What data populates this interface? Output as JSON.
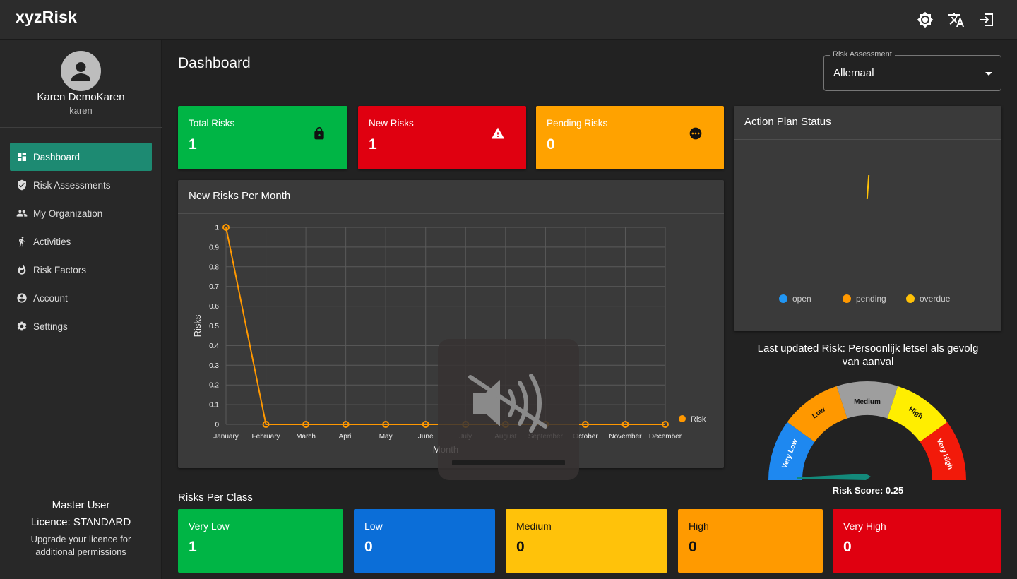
{
  "app": {
    "logo": "xyzRisk"
  },
  "topbar": {
    "icons": [
      "brightness-icon",
      "translate-icon",
      "logout-icon"
    ]
  },
  "user": {
    "name": "Karen DemoKaren",
    "login": "karen"
  },
  "nav": {
    "items": [
      {
        "label": "Dashboard",
        "icon": "dashboard-icon",
        "active": true
      },
      {
        "label": "Risk Assessments",
        "icon": "shield-check-icon",
        "active": false
      },
      {
        "label": "My Organization",
        "icon": "people-icon",
        "active": false
      },
      {
        "label": "Activities",
        "icon": "walk-icon",
        "active": false
      },
      {
        "label": "Risk Factors",
        "icon": "fire-icon",
        "active": false
      },
      {
        "label": "Account",
        "icon": "account-circle-icon",
        "active": false
      },
      {
        "label": "Settings",
        "icon": "gear-icon",
        "active": false
      }
    ]
  },
  "licence": {
    "role": "Master User",
    "type": "Licence: STANDARD",
    "note": "Upgrade your licence for additional permissions"
  },
  "page": {
    "title": "Dashboard"
  },
  "filter": {
    "label": "Risk Assessment",
    "value": "Allemaal"
  },
  "stats": [
    {
      "label": "Total Risks",
      "value": "1",
      "color": "#00b545",
      "icon": "lock-icon"
    },
    {
      "label": "New Risks",
      "value": "1",
      "color": "#e00010",
      "icon": "warning-icon"
    },
    {
      "label": "Pending Risks",
      "value": "0",
      "color": "#ffa200",
      "icon": "more-horiz-circle-icon"
    }
  ],
  "line_panel": {
    "title": "New Risks Per Month"
  },
  "action_panel": {
    "title": "Action Plan Status",
    "legend": [
      {
        "label": "open",
        "color": "#2196f3"
      },
      {
        "label": "pending",
        "color": "#ff9800"
      },
      {
        "label": "overdue",
        "color": "#ffc107"
      }
    ]
  },
  "gauge": {
    "title": "Last updated Risk: Persoonlijk letsel als gevolg van aanval",
    "score_label": "Risk Score: 0.25",
    "segments": [
      {
        "label": "Very Low",
        "color": "#1e88f0"
      },
      {
        "label": "Low",
        "color": "#ff9800"
      },
      {
        "label": "Medium",
        "color": "#9e9e9e"
      },
      {
        "label": "High",
        "color": "#ffee00"
      },
      {
        "label": "Very High",
        "color": "#f21a0a"
      }
    ],
    "needle_color": "#13897a"
  },
  "classes": {
    "title": "Risks Per Class",
    "items": [
      {
        "label": "Very Low",
        "value": "1",
        "color": "#00b545"
      },
      {
        "label": "Low",
        "value": "0",
        "color": "#0b6ed8"
      },
      {
        "label": "Medium",
        "value": "0",
        "color": "#ffc20a"
      },
      {
        "label": "High",
        "value": "0",
        "color": "#ff9a00"
      },
      {
        "label": "Very High",
        "value": "0",
        "color": "#e00010"
      }
    ]
  },
  "overlay": {
    "icon": "volume-off-icon"
  },
  "chart_data": {
    "type": "line",
    "title": "",
    "xlabel": "Month",
    "ylabel": "Risks",
    "categories": [
      "January",
      "February",
      "March",
      "April",
      "May",
      "June",
      "July",
      "August",
      "September",
      "October",
      "November",
      "December"
    ],
    "series": [
      {
        "name": "Risk",
        "values": [
          1,
          0,
          0,
          0,
          0,
          0,
          0,
          0,
          0,
          0,
          0,
          0
        ],
        "color": "#ff9800"
      }
    ],
    "ylim": [
      0,
      1
    ],
    "yticks": [
      "0",
      "0.1",
      "0.2",
      "0.3",
      "0.4",
      "0.5",
      "0.6",
      "0.7",
      "0.8",
      "0.9",
      "1"
    ],
    "grid": true,
    "legend": "right"
  }
}
